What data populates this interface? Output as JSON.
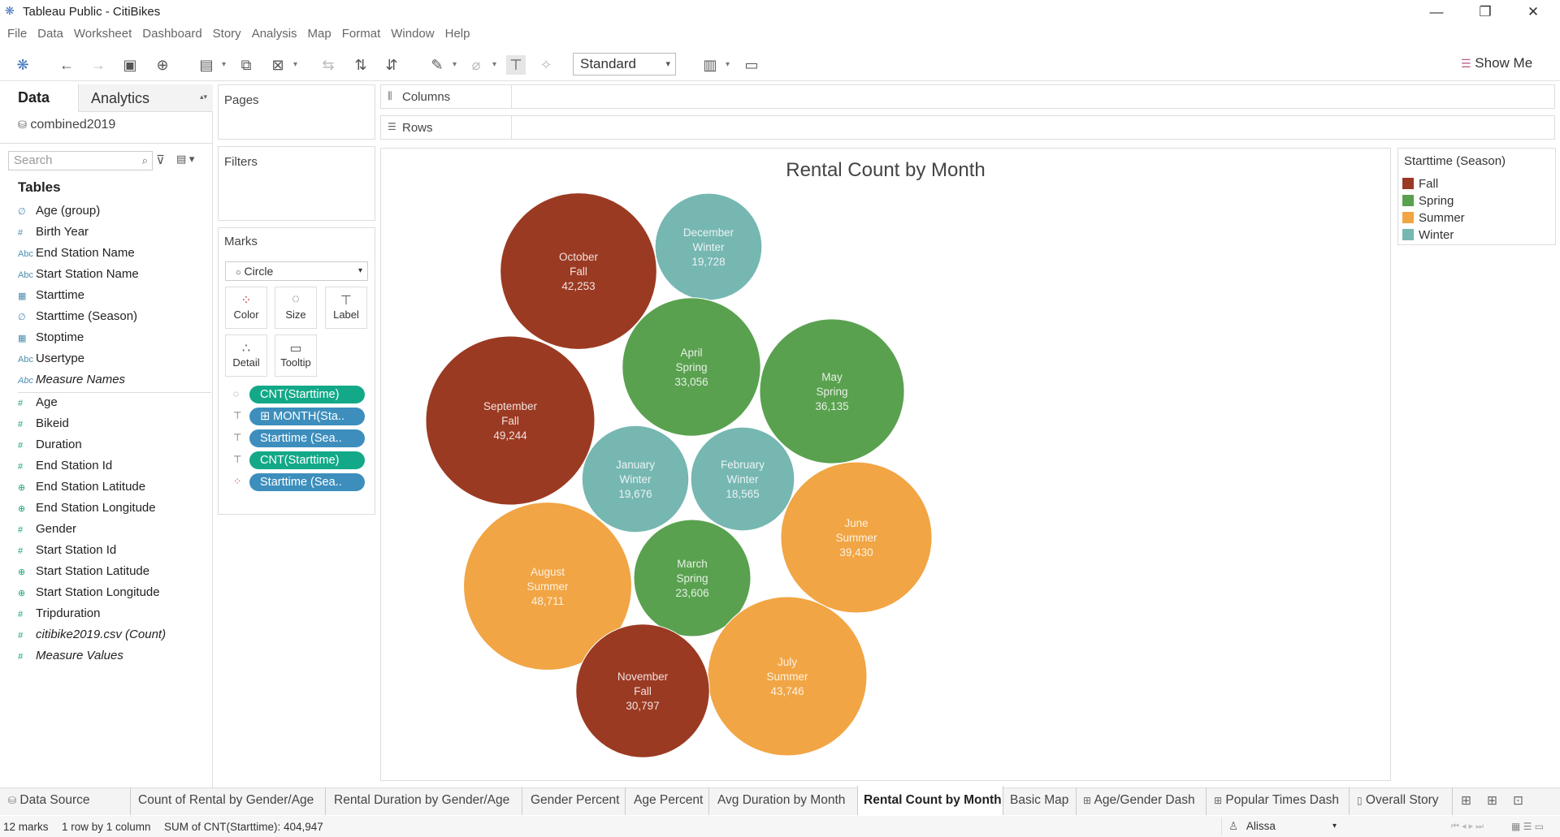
{
  "window": {
    "title": "Tableau Public - CitiBikes",
    "min": "—",
    "restore": "❐",
    "close": "✕"
  },
  "menu": [
    "File",
    "Data",
    "Worksheet",
    "Dashboard",
    "Story",
    "Analysis",
    "Map",
    "Format",
    "Window",
    "Help"
  ],
  "toolbar": {
    "fit_select": "Standard",
    "show_me": "Show Me"
  },
  "left_pane": {
    "tabs": {
      "data": "Data",
      "analytics": "Analytics"
    },
    "data_source": "combined2019",
    "search_placeholder": "Search",
    "tables_header": "Tables",
    "dimensions": [
      {
        "icon": "∅",
        "name": "Age (group)"
      },
      {
        "icon": "#",
        "name": "Birth Year"
      },
      {
        "icon": "Abc",
        "name": "End Station Name"
      },
      {
        "icon": "Abc",
        "name": "Start Station Name"
      },
      {
        "icon": "▦",
        "name": "Starttime"
      },
      {
        "icon": "∅",
        "name": "Starttime (Season)"
      },
      {
        "icon": "▦",
        "name": "Stoptime"
      },
      {
        "icon": "Abc",
        "name": "Usertype"
      },
      {
        "icon": "Abc",
        "name": "Measure Names"
      }
    ],
    "measures": [
      {
        "icon": "#",
        "name": "Age"
      },
      {
        "icon": "#",
        "name": "Bikeid"
      },
      {
        "icon": "#",
        "name": "Duration"
      },
      {
        "icon": "#",
        "name": "End Station Id"
      },
      {
        "icon": "⊕",
        "name": "End Station Latitude"
      },
      {
        "icon": "⊕",
        "name": "End Station Longitude"
      },
      {
        "icon": "#",
        "name": "Gender"
      },
      {
        "icon": "#",
        "name": "Start Station Id"
      },
      {
        "icon": "⊕",
        "name": "Start Station Latitude"
      },
      {
        "icon": "⊕",
        "name": "Start Station Longitude"
      },
      {
        "icon": "#",
        "name": "Tripduration"
      },
      {
        "icon": "#",
        "name": "citibike2019.csv (Count)"
      },
      {
        "icon": "#",
        "name": "Measure Values"
      }
    ]
  },
  "cards": {
    "pages": "Pages",
    "filters": "Filters",
    "marks": "Marks",
    "mark_type": "Circle",
    "mark_buttons": {
      "color": "Color",
      "size": "Size",
      "label": "Label",
      "detail": "Detail",
      "tooltip": "Tooltip"
    },
    "pills": [
      "CNT(Starttime)",
      "⊞ MONTH(Sta..",
      "Starttime (Sea..",
      "CNT(Starttime)",
      "Starttime (Sea.."
    ],
    "columns": "Columns",
    "rows": "Rows"
  },
  "legend": {
    "title": "Starttime (Season)",
    "items": [
      {
        "label": "Fall",
        "color": "#9b3a22"
      },
      {
        "label": "Spring",
        "color": "#59a14f"
      },
      {
        "label": "Summer",
        "color": "#f1a544"
      },
      {
        "label": "Winter",
        "color": "#76b7b2"
      }
    ]
  },
  "chart_data": {
    "type": "packed-bubble",
    "title": "Rental Count by Month",
    "measure": "CNT(Starttime)",
    "points": [
      {
        "month": "October",
        "season": "Fall",
        "value": "42,253"
      },
      {
        "month": "December",
        "season": "Winter",
        "value": "19,728"
      },
      {
        "month": "April",
        "season": "Spring",
        "value": "33,056"
      },
      {
        "month": "May",
        "season": "Spring",
        "value": "36,135"
      },
      {
        "month": "September",
        "season": "Fall",
        "value": "49,244"
      },
      {
        "month": "January",
        "season": "Winter",
        "value": "19,676"
      },
      {
        "month": "February",
        "season": "Winter",
        "value": "18,565"
      },
      {
        "month": "June",
        "season": "Summer",
        "value": "39,430"
      },
      {
        "month": "August",
        "season": "Summer",
        "value": "48,711"
      },
      {
        "month": "March",
        "season": "Spring",
        "value": "23,606"
      },
      {
        "month": "July",
        "season": "Summer",
        "value": "43,746"
      },
      {
        "month": "November",
        "season": "Fall",
        "value": "30,797"
      }
    ]
  },
  "sheet_tabs": [
    "Data Source",
    "Count of Rental by Gender/Age",
    "Rental Duration by Gender/Age",
    "Gender Percent",
    "Age Percent",
    "Avg Duration by Month",
    "Rental Count by Month",
    "Basic Map",
    "Age/Gender Dash",
    "Popular Times Dash",
    "Overall Story"
  ],
  "status": {
    "marks": "12 marks",
    "rows": "1 row by 1 column",
    "sum": "SUM of CNT(Starttime): 404,947",
    "user": "Alissa"
  }
}
